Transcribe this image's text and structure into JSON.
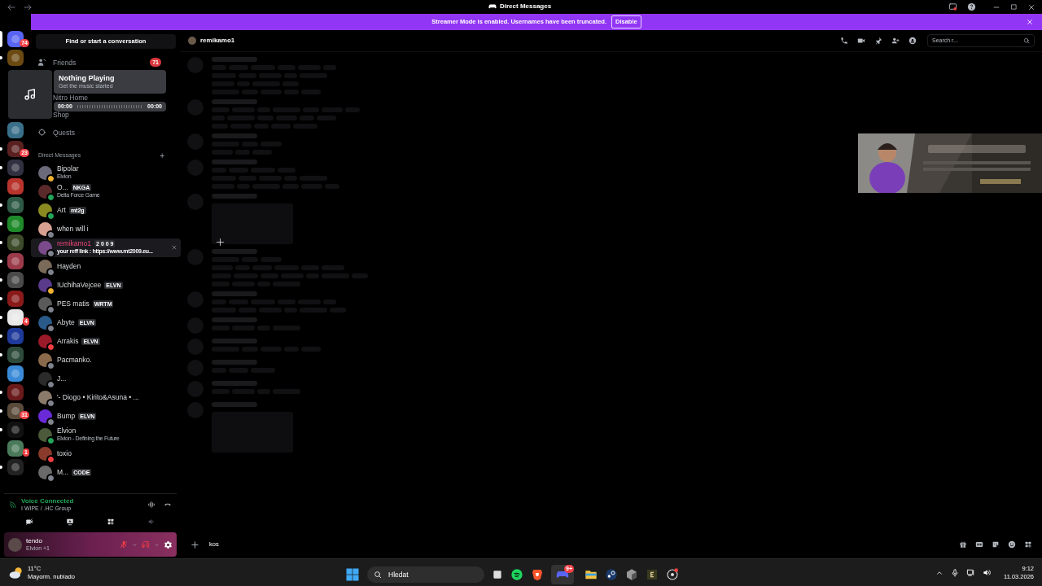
{
  "window": {
    "title": "Direct Messages"
  },
  "banner": {
    "text": "Streamer Mode is enabled. Usernames have been truncated.",
    "button": "Disable"
  },
  "servers": [
    {
      "color": "#5865f2",
      "badge": "74",
      "unread": false,
      "selected": true
    },
    {
      "color": "#6b4a12",
      "unread": true,
      "selected": false
    },
    {
      "color": "#3a6f8a",
      "unread": false,
      "selected": false
    },
    {
      "color": "#5a2020",
      "badge": "23",
      "unread": true,
      "selected": false
    },
    {
      "color": "#2f3140",
      "unread": true,
      "selected": false
    },
    {
      "color": "#b8342c",
      "unread": false,
      "selected": false
    },
    {
      "color": "#2e5a45",
      "unread": true,
      "selected": false
    },
    {
      "color": "#1f8a2a",
      "unread": true,
      "selected": false
    },
    {
      "color": "#3d4a2a",
      "unread": true,
      "selected": false
    },
    {
      "color": "#9b3b4a",
      "unread": true,
      "selected": false
    },
    {
      "color": "#4a4a4a",
      "unread": true,
      "selected": false
    },
    {
      "color": "#8a1a1a",
      "unread": true,
      "selected": false
    },
    {
      "color": "#e8e8e8",
      "badge": "4",
      "unread": true,
      "selected": false
    },
    {
      "color": "#1e3a9a",
      "unread": true,
      "selected": false
    },
    {
      "color": "#2d4a3a",
      "unread": true,
      "selected": false
    },
    {
      "color": "#3a8ad8",
      "unread": false,
      "selected": false
    },
    {
      "color": "#6a1a1a",
      "unread": true,
      "selected": false
    },
    {
      "color": "#5a4a3a",
      "badge": "31",
      "unread": true,
      "selected": false
    },
    {
      "color": "#111111",
      "unread": true,
      "selected": false
    },
    {
      "color": "#4a7a5a",
      "badge": "1",
      "unread": false,
      "selected": false
    },
    {
      "color": "#222222",
      "unread": true,
      "selected": false
    }
  ],
  "search": {
    "placeholder": "Find or start a conversation"
  },
  "nav": [
    {
      "label": "Friends",
      "badge": "71",
      "kind": "friends"
    },
    {
      "label": "Nitro Home",
      "kind": "nitro"
    },
    {
      "label": "Shop",
      "kind": "shop"
    },
    {
      "label": "Quests",
      "kind": "quests"
    }
  ],
  "now_playing": {
    "title": "Nothing Playing",
    "subtitle": "Get the music started",
    "elapsed": "00:00",
    "total": "00:00",
    "level": 0
  },
  "dm_header": {
    "label": "Direct Messages",
    "add": "+"
  },
  "dms": [
    {
      "name": "Bipolar",
      "subtitle": "Elvion",
      "color": "#f0b232",
      "selected": false
    },
    {
      "name": "O...",
      "tag": "NKGA",
      "subtitle": "Delta Force Game",
      "color": "#23a55a",
      "selected": false
    },
    {
      "name": "Art",
      "tag": "mt2g",
      "color": "#23a55a",
      "selected": false
    },
    {
      "name": "when will i",
      "color": "#80848e",
      "selected": false
    },
    {
      "name": "remikamo1",
      "tag": "2 0 0 9",
      "subtitle": "your reff link : https://www.mt2009.eu...",
      "color": "#80848e",
      "selected": true
    },
    {
      "name": "Hayden",
      "color": "#80848e",
      "selected": false
    },
    {
      "name": "!UchihaVejcee",
      "tag": "ELVN",
      "color": "#f0b232",
      "selected": false
    },
    {
      "name": "PES matis",
      "tag": "WRTM",
      "color": "#80848e",
      "selected": false
    },
    {
      "name": "Abyte",
      "tag": "ELVN",
      "color": "#80848e",
      "selected": false
    },
    {
      "name": "Arrakis",
      "tag": "ELVN",
      "color": "#f23f43",
      "selected": false
    },
    {
      "name": "Pacmanko.",
      "color": "#80848e",
      "selected": false
    },
    {
      "name": "J...",
      "color": "#80848e",
      "selected": false
    },
    {
      "name": "'- Diogo • Kirito&Asuna • ...",
      "color": "#80848e",
      "selected": false
    },
    {
      "name": "Bump",
      "tag": "ELVN",
      "color": "#80848e",
      "selected": false
    },
    {
      "name": "Elvion",
      "subtitle": "Elvion - Defining the Future",
      "color": "#23a55a",
      "selected": false
    },
    {
      "name": "toxio",
      "color": "#f23f43",
      "selected": false
    },
    {
      "name": "M...",
      "tag": "CODE",
      "color": "#80848e",
      "selected": false
    }
  ],
  "voice": {
    "title": "Voice Connected",
    "channel": "I WIPE / .HC Group"
  },
  "user": {
    "name": "tendo",
    "status": "Elvion +1"
  },
  "channel": {
    "name": "remikamo1",
    "search_placeholder": "Search r..."
  },
  "composer": {
    "value": "kos"
  },
  "taskbar": {
    "temperature": "11°C",
    "weather": "Mayorm. nublado",
    "search": "Hledat",
    "discord_badge": "9+",
    "time": "9:12",
    "date": "11.03.2026"
  }
}
